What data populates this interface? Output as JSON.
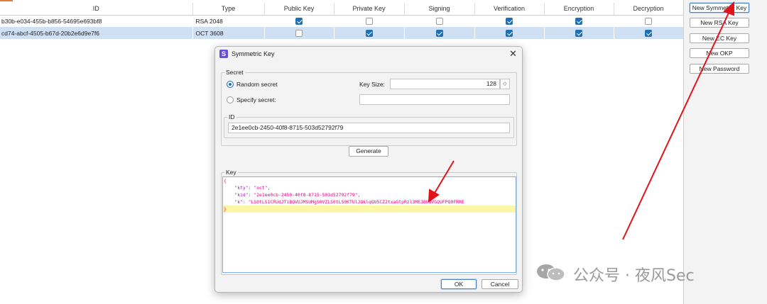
{
  "table": {
    "columns": [
      "ID",
      "Type",
      "Public Key",
      "Private Key",
      "Signing",
      "Verification",
      "Encryption",
      "Decryption"
    ],
    "rows": [
      {
        "id": "b30b-e034-455b-b856-54695e693bf8",
        "type": "RSA 2048",
        "public_key": true,
        "private_key": false,
        "signing": false,
        "verification": true,
        "encryption": true,
        "decryption": false,
        "selected": false
      },
      {
        "id": "cd74-abcf-4505-b67d-20b2e6d9e7f6",
        "type": "OCT 3608",
        "public_key": false,
        "private_key": true,
        "signing": true,
        "verification": true,
        "encryption": true,
        "decryption": true,
        "selected": true
      }
    ]
  },
  "side_buttons": [
    "New Symmetric Key",
    "New RSA Key",
    "New EC Key",
    "New OKP",
    "New Password"
  ],
  "dialog": {
    "title": "Symmetric Key",
    "logo_glyph": "S",
    "close_glyph": "✕",
    "secret_group": "Secret",
    "random_secret": "Random secret",
    "specify_secret": "Specify secret:",
    "random_selected": true,
    "key_size_label": "Key Size:",
    "key_size_value": "128",
    "spinner_glyph": "◇",
    "specify_value": "",
    "id_group": "ID",
    "id_value": "2e1ee0cb-2450-40f8-8715-503d52792f79",
    "generate": "Generate",
    "key_group": "Key",
    "key_json": {
      "open": "{",
      "close": "}",
      "kty_key": "\"kty\"",
      "kty_val": "\"oct\"",
      "kid_key": "\"kid\"",
      "kid_val": "\"2e1ee0cb-2450-40f8-8715-503d52792f79\"",
      "k_key": "\"k\"",
      "k_val": "\"LS0tLS1CRUdJTiBQVUJMSUMgS0VZLS0tLS0KTUlJQklqQU5CZ2txaGtpRzl3MEJBUUVGQUFPQ0FRRE"
    },
    "ok": "OK",
    "cancel": "Cancel"
  },
  "watermark": {
    "text": "公众号 · 夜风Sec",
    "icon": "wechat-icon"
  },
  "colors": {
    "accent": "#1f6fb5",
    "selection": "#cfe0f4",
    "annotation_arrow": "#e0151b"
  }
}
